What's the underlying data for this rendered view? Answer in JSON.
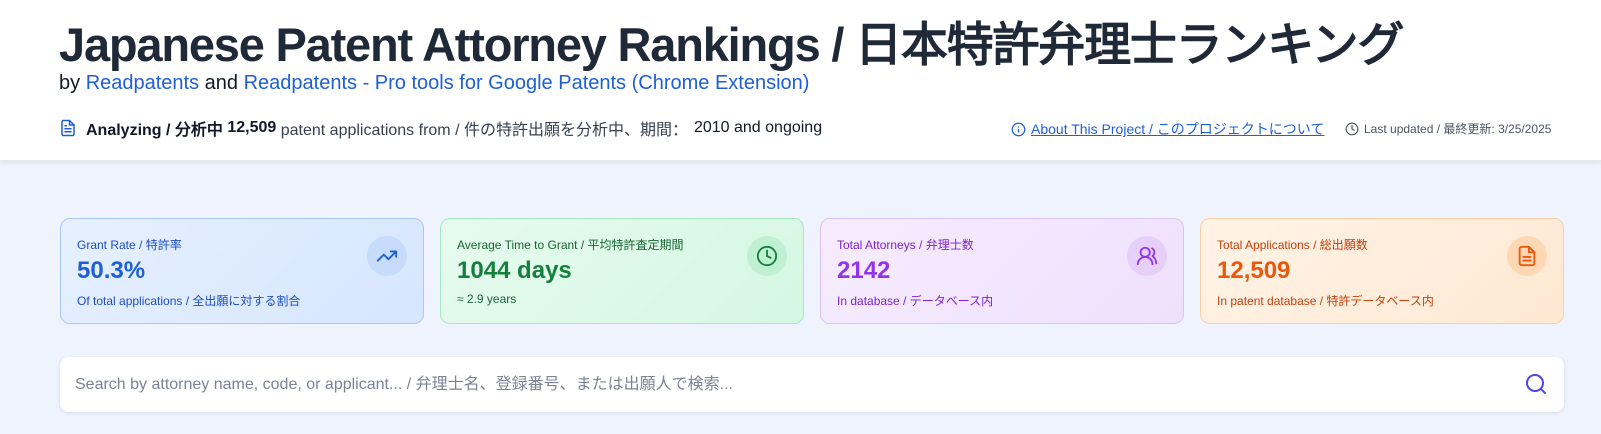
{
  "header": {
    "title": "Japanese Patent Attorney Rankings / 日本特許弁理士ランキング",
    "by": "by",
    "link1": "Readpatents",
    "and": "and",
    "link2": "Readpatents - Pro tools for Google Patents (Chrome Extension)",
    "analyzing_label": "Analyzing / 分析中",
    "analyzing_count": "12,509",
    "analyzing_text": "patent applications from / 件の特許出願を分析中、期間：",
    "analyzing_period": "2010 and ongoing",
    "about_link": "About This Project / このプロジェクトについて",
    "last_updated": "Last updated / 最終更新: 3/25/2025"
  },
  "stats": [
    {
      "label_en": "Grant Rate",
      "label_jp": " / 特許率",
      "value": "50.3%",
      "sub": "Of total applications / 全出願に対する割合",
      "icon": "trending-up-icon"
    },
    {
      "label_en": "Average Time to Grant",
      "label_jp": " / 平均特許査定期間",
      "value": "1044 days",
      "sub": "≈ 2.9 years",
      "icon": "clock-icon"
    },
    {
      "label_en": "Total Attorneys",
      "label_jp": " / 弁理士数",
      "value": "2142",
      "sub": "In database / データベース内",
      "icon": "users-icon"
    },
    {
      "label_en": "Total Applications",
      "label_jp": " / 総出願数",
      "value": "12,509",
      "sub": "In patent database / 特許データベース内",
      "icon": "document-icon"
    }
  ],
  "search": {
    "placeholder": "Search by attorney name, code, or applicant... / 弁理士名、登録番号、または出願人で検索..."
  },
  "colors": {
    "link": "#1d5fd6",
    "grant": "#1d5fd6",
    "time": "#15803d",
    "attorneys": "#9333ea",
    "applications": "#ea580c",
    "search_icon": "#4f46e5"
  }
}
